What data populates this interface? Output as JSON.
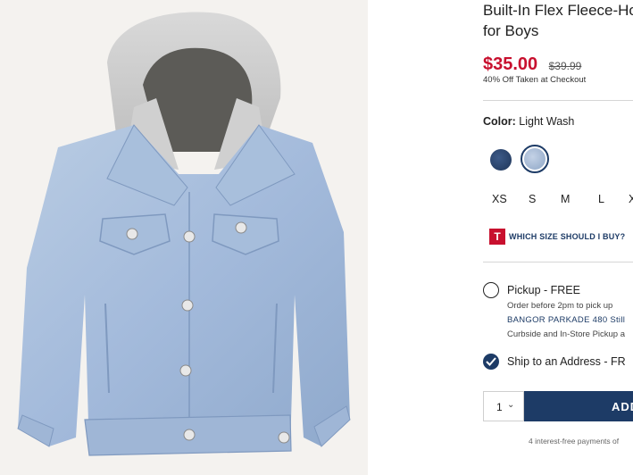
{
  "product": {
    "title_line1": "Built-In Flex Fleece-Hooded Jean Jacket",
    "title_line2": "for Boys",
    "price_current": "$35.00",
    "price_original": "$39.99",
    "promo": "40% Off Taken at Checkout",
    "image_alt": "Light wash denim jacket with gray fleece hood"
  },
  "color": {
    "label": "Color:",
    "value": "Light Wash",
    "swatches": [
      {
        "name": "Dark Wash",
        "hex": "#2b4470",
        "selected": false
      },
      {
        "name": "Light Wash",
        "hex": "#a9bcd6",
        "selected": true
      }
    ]
  },
  "sizes": [
    "XS",
    "S",
    "M",
    "L",
    "XL"
  ],
  "size_guide": {
    "logo": "T",
    "text": "WHICH SIZE SHOULD I BUY?"
  },
  "fulfillment": {
    "pickup": {
      "title": "Pickup - FREE",
      "line1": "Order before 2pm to pick up",
      "store": "BANGOR PARKADE 480 Still",
      "line3": "Curbside and In-Store Pickup a",
      "selected": false
    },
    "ship": {
      "title": "Ship to an Address - FR",
      "selected": true
    }
  },
  "cart": {
    "quantity": "1",
    "add_label": "ADD"
  },
  "installments": "4 interest-free payments of",
  "colors": {
    "accent_red": "#c8102e",
    "navy": "#1d3b66"
  }
}
